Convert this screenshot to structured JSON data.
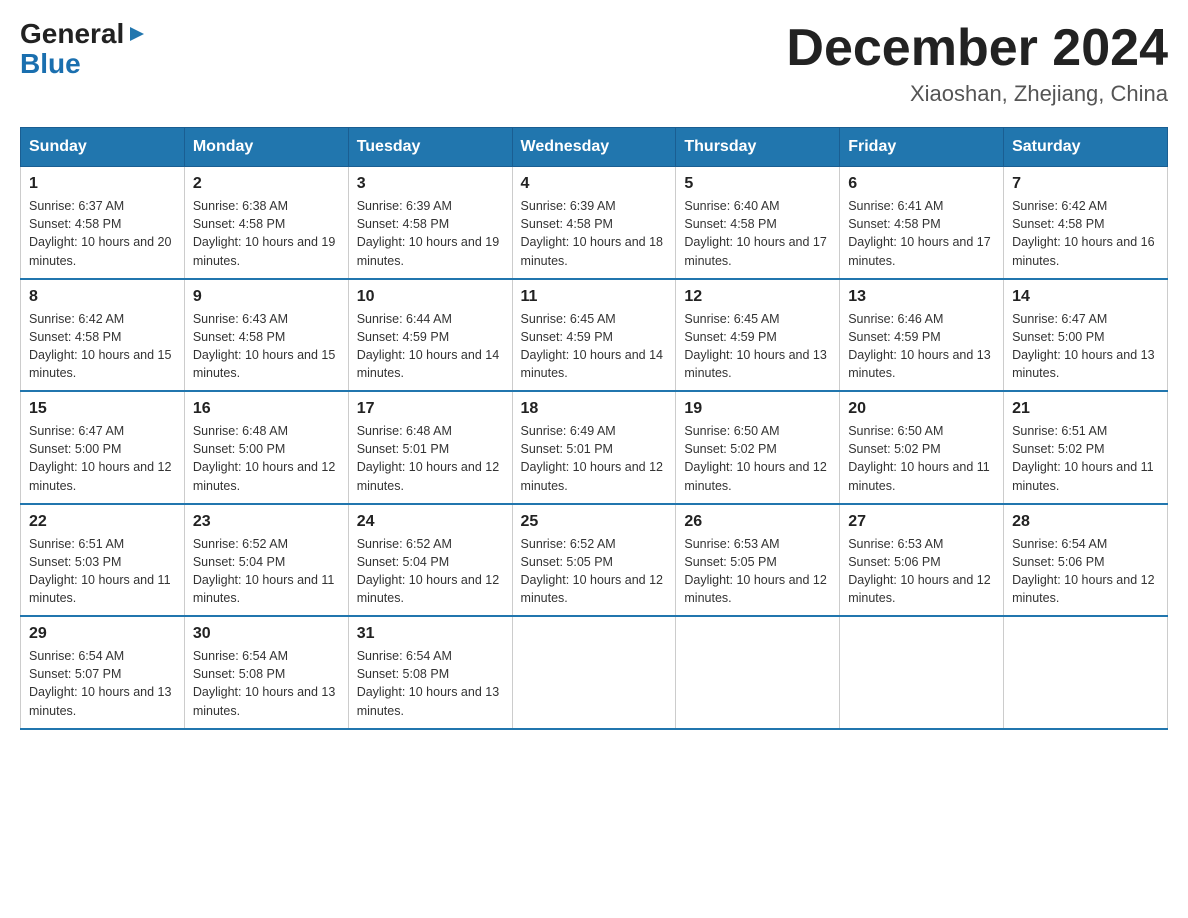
{
  "header": {
    "logo_general": "General",
    "logo_blue": "Blue",
    "month_title": "December 2024",
    "location": "Xiaoshan, Zhejiang, China"
  },
  "days_of_week": [
    "Sunday",
    "Monday",
    "Tuesday",
    "Wednesday",
    "Thursday",
    "Friday",
    "Saturday"
  ],
  "weeks": [
    [
      {
        "day": "1",
        "sunrise": "6:37 AM",
        "sunset": "4:58 PM",
        "daylight": "10 hours and 20 minutes."
      },
      {
        "day": "2",
        "sunrise": "6:38 AM",
        "sunset": "4:58 PM",
        "daylight": "10 hours and 19 minutes."
      },
      {
        "day": "3",
        "sunrise": "6:39 AM",
        "sunset": "4:58 PM",
        "daylight": "10 hours and 19 minutes."
      },
      {
        "day": "4",
        "sunrise": "6:39 AM",
        "sunset": "4:58 PM",
        "daylight": "10 hours and 18 minutes."
      },
      {
        "day": "5",
        "sunrise": "6:40 AM",
        "sunset": "4:58 PM",
        "daylight": "10 hours and 17 minutes."
      },
      {
        "day": "6",
        "sunrise": "6:41 AM",
        "sunset": "4:58 PM",
        "daylight": "10 hours and 17 minutes."
      },
      {
        "day": "7",
        "sunrise": "6:42 AM",
        "sunset": "4:58 PM",
        "daylight": "10 hours and 16 minutes."
      }
    ],
    [
      {
        "day": "8",
        "sunrise": "6:42 AM",
        "sunset": "4:58 PM",
        "daylight": "10 hours and 15 minutes."
      },
      {
        "day": "9",
        "sunrise": "6:43 AM",
        "sunset": "4:58 PM",
        "daylight": "10 hours and 15 minutes."
      },
      {
        "day": "10",
        "sunrise": "6:44 AM",
        "sunset": "4:59 PM",
        "daylight": "10 hours and 14 minutes."
      },
      {
        "day": "11",
        "sunrise": "6:45 AM",
        "sunset": "4:59 PM",
        "daylight": "10 hours and 14 minutes."
      },
      {
        "day": "12",
        "sunrise": "6:45 AM",
        "sunset": "4:59 PM",
        "daylight": "10 hours and 13 minutes."
      },
      {
        "day": "13",
        "sunrise": "6:46 AM",
        "sunset": "4:59 PM",
        "daylight": "10 hours and 13 minutes."
      },
      {
        "day": "14",
        "sunrise": "6:47 AM",
        "sunset": "5:00 PM",
        "daylight": "10 hours and 13 minutes."
      }
    ],
    [
      {
        "day": "15",
        "sunrise": "6:47 AM",
        "sunset": "5:00 PM",
        "daylight": "10 hours and 12 minutes."
      },
      {
        "day": "16",
        "sunrise": "6:48 AM",
        "sunset": "5:00 PM",
        "daylight": "10 hours and 12 minutes."
      },
      {
        "day": "17",
        "sunrise": "6:48 AM",
        "sunset": "5:01 PM",
        "daylight": "10 hours and 12 minutes."
      },
      {
        "day": "18",
        "sunrise": "6:49 AM",
        "sunset": "5:01 PM",
        "daylight": "10 hours and 12 minutes."
      },
      {
        "day": "19",
        "sunrise": "6:50 AM",
        "sunset": "5:02 PM",
        "daylight": "10 hours and 12 minutes."
      },
      {
        "day": "20",
        "sunrise": "6:50 AM",
        "sunset": "5:02 PM",
        "daylight": "10 hours and 11 minutes."
      },
      {
        "day": "21",
        "sunrise": "6:51 AM",
        "sunset": "5:02 PM",
        "daylight": "10 hours and 11 minutes."
      }
    ],
    [
      {
        "day": "22",
        "sunrise": "6:51 AM",
        "sunset": "5:03 PM",
        "daylight": "10 hours and 11 minutes."
      },
      {
        "day": "23",
        "sunrise": "6:52 AM",
        "sunset": "5:04 PM",
        "daylight": "10 hours and 11 minutes."
      },
      {
        "day": "24",
        "sunrise": "6:52 AM",
        "sunset": "5:04 PM",
        "daylight": "10 hours and 12 minutes."
      },
      {
        "day": "25",
        "sunrise": "6:52 AM",
        "sunset": "5:05 PM",
        "daylight": "10 hours and 12 minutes."
      },
      {
        "day": "26",
        "sunrise": "6:53 AM",
        "sunset": "5:05 PM",
        "daylight": "10 hours and 12 minutes."
      },
      {
        "day": "27",
        "sunrise": "6:53 AM",
        "sunset": "5:06 PM",
        "daylight": "10 hours and 12 minutes."
      },
      {
        "day": "28",
        "sunrise": "6:54 AM",
        "sunset": "5:06 PM",
        "daylight": "10 hours and 12 minutes."
      }
    ],
    [
      {
        "day": "29",
        "sunrise": "6:54 AM",
        "sunset": "5:07 PM",
        "daylight": "10 hours and 13 minutes."
      },
      {
        "day": "30",
        "sunrise": "6:54 AM",
        "sunset": "5:08 PM",
        "daylight": "10 hours and 13 minutes."
      },
      {
        "day": "31",
        "sunrise": "6:54 AM",
        "sunset": "5:08 PM",
        "daylight": "10 hours and 13 minutes."
      },
      null,
      null,
      null,
      null
    ]
  ]
}
